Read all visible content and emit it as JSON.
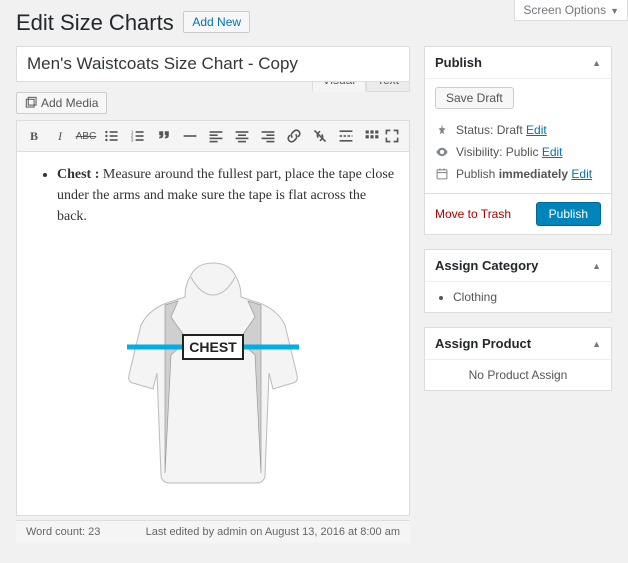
{
  "screenOptions": "Screen Options",
  "pageTitle": "Edit Size Charts",
  "addNew": "Add New",
  "postTitle": "Men's Waistcoats Size Chart - Copy",
  "addMedia": "Add Media",
  "tabs": {
    "visual": "Visual",
    "text": "Text"
  },
  "content": {
    "label": "Chest :",
    "desc": " Measure around the fullest part, place the tape close under the arms and make sure the tape is flat across the back."
  },
  "footer": {
    "wordCountLabel": "Word count: ",
    "wordCountValue": "23",
    "lastEdited": "Last edited by admin on August 13, 2016 at 8:00 am"
  },
  "publish": {
    "title": "Publish",
    "saveDraft": "Save Draft",
    "statusLabel": "Status: ",
    "statusValue": "Draft",
    "visibilityLabel": "Visibility: ",
    "visibilityValue": "Public",
    "scheduleLabel": "Publish ",
    "scheduleValue": "immediately",
    "editLink": "Edit",
    "trash": "Move to Trash",
    "publishBtn": "Publish"
  },
  "assignCategory": {
    "title": "Assign Category",
    "items": [
      "Clothing"
    ]
  },
  "assignProduct": {
    "title": "Assign Product",
    "empty": "No Product Assign"
  },
  "chestGraphic": "CHEST"
}
